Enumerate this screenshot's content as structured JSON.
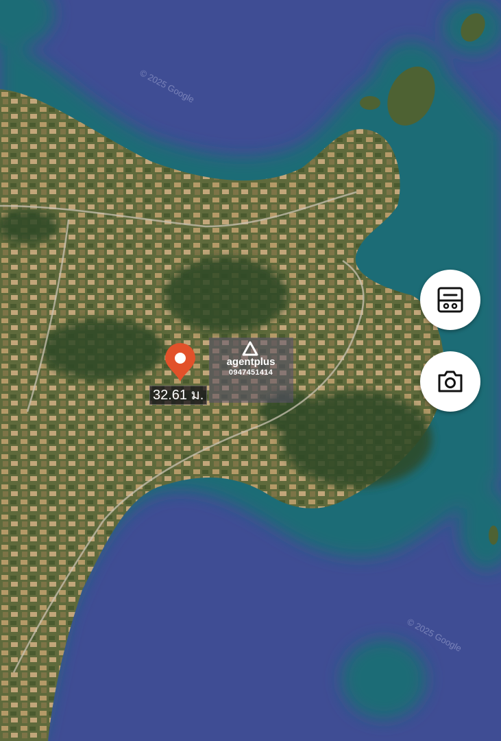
{
  "map": {
    "pin_label": "32.61 ม.",
    "copyright_text": "© 2025 Google",
    "watermark": {
      "name": "agentplus",
      "phone": "0947451414"
    }
  },
  "controls": {
    "storage_icon": "storage-box-icon",
    "camera_icon": "camera-icon"
  },
  "colors": {
    "sea_deep": "#3f4d94",
    "shallow_water": "#1f6c76",
    "land": "#5d6b3e",
    "pin": "#e2512a",
    "button_bg": "#ffffff"
  }
}
